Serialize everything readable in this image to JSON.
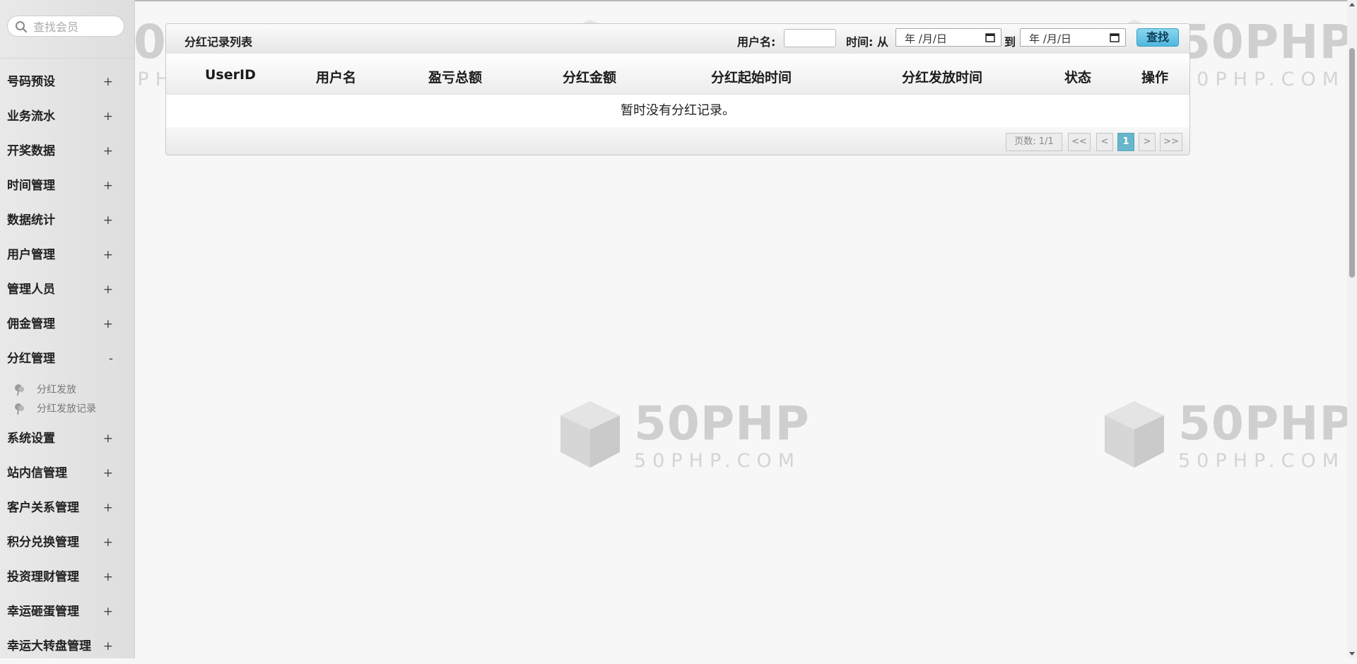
{
  "sidebar": {
    "search_placeholder": "查找会员",
    "menu": [
      {
        "label": "号码预设",
        "toggle": "+"
      },
      {
        "label": "业务流水",
        "toggle": "+"
      },
      {
        "label": "开奖数据",
        "toggle": "+"
      },
      {
        "label": "时间管理",
        "toggle": "+"
      },
      {
        "label": "数据统计",
        "toggle": "+"
      },
      {
        "label": "用户管理",
        "toggle": "+"
      },
      {
        "label": "管理人员",
        "toggle": "+"
      },
      {
        "label": "佣金管理",
        "toggle": "+"
      },
      {
        "label": "分红管理",
        "toggle": "-"
      }
    ],
    "submenu": [
      {
        "label": "分红发放"
      },
      {
        "label": "分红发放记录"
      }
    ],
    "menu_after": [
      {
        "label": "系统设置",
        "toggle": "+"
      },
      {
        "label": "站内信管理",
        "toggle": "+"
      },
      {
        "label": "客户关系管理",
        "toggle": "+"
      },
      {
        "label": "积分兑换管理",
        "toggle": "+"
      },
      {
        "label": "投资理财管理",
        "toggle": "+"
      },
      {
        "label": "幸运砸蛋管理",
        "toggle": "+"
      },
      {
        "label": "幸运大转盘管理",
        "toggle": "+"
      }
    ]
  },
  "watermark": {
    "big": "50PHP",
    "small": "50PHP.COM"
  },
  "panel": {
    "title": "分红记录列表",
    "filter": {
      "username_label": "用户名:",
      "time_label": "时间: 从",
      "to_label": "到",
      "date_placeholder": "年 /月/日",
      "search_button": "查找"
    },
    "columns": [
      "UserID",
      "用户名",
      "盈亏总额",
      "分红金额",
      "分红起始时间",
      "分红发放时间",
      "状态",
      "操作"
    ],
    "empty_message": "暂时没有分红记录。",
    "pagination": {
      "page_info": "页数: 1/1",
      "first": "<<",
      "prev": "<",
      "current": "1",
      "next": ">",
      "last": ">>"
    }
  },
  "colors": {
    "accent": "#4fb8de",
    "active_page": "#67b6cb",
    "sidebar_bg": "#e4e4e4"
  },
  "icons": {
    "search": "search-icon",
    "calendar": "calendar-icon",
    "submenu": "pin-icon",
    "watermark": "cube-logo-icon"
  }
}
